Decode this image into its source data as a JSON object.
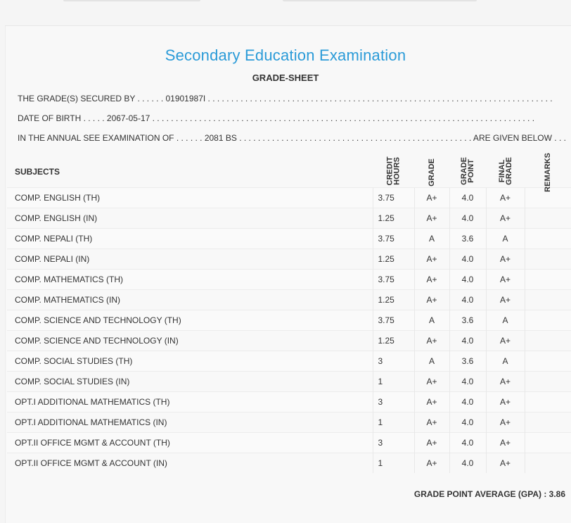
{
  "header": {
    "title": "Secondary Education Examination",
    "subtitle": "GRADE-SHEET"
  },
  "info": {
    "line1": "THE GRADE(S) SECURED BY . . . . . . 01901987I . . . . . . . . . . . . . . . . . . . . . . . . . . . . . . . . . . . . . . . . . . . . . . . . . . . . . . . . . . . . . . . . . . . . . . . . . .",
    "line2": "DATE OF BIRTH . . . . . 2067-05-17 . . . . . . . . . . . . . . . . . . . . . . . . . . . . . . . . . . . . . . . . . . . . . . . . . . . . . . . . . . . . . . . . . . . . . . . . . . . . . . . . . .",
    "line3": "IN THE ANNUAL SEE EXAMINATION OF . . . . . . 2081 BS . . . . . . . . . . . . . . . . . . . . . . . . . . . . . . . . . . . . . . . . . . . . . . . . . . ARE GIVEN BELOW . . ."
  },
  "table": {
    "headers": {
      "subjects": "SUBJECTS",
      "credit_hours_1": "CREDIT",
      "credit_hours_2": "HOURS",
      "grade": "GRADE",
      "grade_point_1": "GRADE",
      "grade_point_2": "POINT",
      "final_grade_1": "FINAL",
      "final_grade_2": "GRADE",
      "remarks": "REMARKS"
    },
    "rows": [
      {
        "subject": "COMP. ENGLISH (TH)",
        "credit": "3.75",
        "grade": "A+",
        "point": "4.0",
        "final": "A+"
      },
      {
        "subject": "COMP. ENGLISH (IN)",
        "credit": "1.25",
        "grade": "A+",
        "point": "4.0",
        "final": "A+"
      },
      {
        "subject": "COMP. NEPALI (TH)",
        "credit": "3.75",
        "grade": "A",
        "point": "3.6",
        "final": "A"
      },
      {
        "subject": "COMP. NEPALI (IN)",
        "credit": "1.25",
        "grade": "A+",
        "point": "4.0",
        "final": "A+"
      },
      {
        "subject": "COMP. MATHEMATICS (TH)",
        "credit": "3.75",
        "grade": "A+",
        "point": "4.0",
        "final": "A+"
      },
      {
        "subject": "COMP. MATHEMATICS (IN)",
        "credit": "1.25",
        "grade": "A+",
        "point": "4.0",
        "final": "A+"
      },
      {
        "subject": "COMP. SCIENCE AND TECHNOLOGY (TH)",
        "credit": "3.75",
        "grade": "A",
        "point": "3.6",
        "final": "A"
      },
      {
        "subject": "COMP. SCIENCE AND TECHNOLOGY (IN)",
        "credit": "1.25",
        "grade": "A+",
        "point": "4.0",
        "final": "A+"
      },
      {
        "subject": "COMP. SOCIAL STUDIES (TH)",
        "credit": "3",
        "grade": "A",
        "point": "3.6",
        "final": "A"
      },
      {
        "subject": "COMP. SOCIAL STUDIES (IN)",
        "credit": "1",
        "grade": "A+",
        "point": "4.0",
        "final": "A+"
      },
      {
        "subject": "OPT.I ADDITIONAL MATHEMATICS (TH)",
        "credit": "3",
        "grade": "A+",
        "point": "4.0",
        "final": "A+"
      },
      {
        "subject": "OPT.I ADDITIONAL MATHEMATICS (IN)",
        "credit": "1",
        "grade": "A+",
        "point": "4.0",
        "final": "A+"
      },
      {
        "subject": "OPT.II OFFICE MGMT & ACCOUNT (TH)",
        "credit": "3",
        "grade": "A+",
        "point": "4.0",
        "final": "A+"
      },
      {
        "subject": "OPT.II OFFICE MGMT & ACCOUNT (IN)",
        "credit": "1",
        "grade": "A+",
        "point": "4.0",
        "final": "A+"
      }
    ]
  },
  "gpa": {
    "label": "GRADE POINT AVERAGE (GPA) : 3.86"
  },
  "colors": {
    "title": "#2b9bd8",
    "text": "#333333",
    "background": "#f5f5f5"
  }
}
